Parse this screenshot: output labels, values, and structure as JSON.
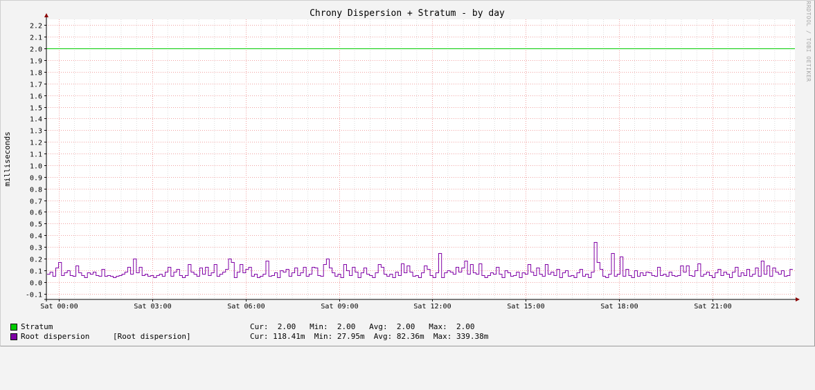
{
  "chart_data": {
    "type": "line",
    "title": "Chrony Dispersion + Stratum - by day",
    "ylabel": "milliseconds",
    "watermark": "RRDTOOL / TOBI OETIKER",
    "ylim": [
      -0.15,
      2.25
    ],
    "y_ticks": [
      "-0.1",
      "0.0",
      "0.1",
      "0.2",
      "0.3",
      "0.4",
      "0.5",
      "0.6",
      "0.7",
      "0.8",
      "0.9",
      "1.0",
      "1.1",
      "1.2",
      "1.3",
      "1.4",
      "1.5",
      "1.6",
      "1.7",
      "1.8",
      "1.9",
      "2.0",
      "2.1",
      "2.2"
    ],
    "y_tick_values": [
      -0.1,
      0.0,
      0.1,
      0.2,
      0.3,
      0.4,
      0.5,
      0.6,
      0.7,
      0.8,
      0.9,
      1.0,
      1.1,
      1.2,
      1.3,
      1.4,
      1.5,
      1.6,
      1.7,
      1.8,
      1.9,
      2.0,
      2.1,
      2.2
    ],
    "xlim_hours": [
      23.6,
      47.65
    ],
    "x_ticks": [
      "Sat 00:00",
      "Sat 03:00",
      "Sat 06:00",
      "Sat 09:00",
      "Sat 12:00",
      "Sat 15:00",
      "Sat 18:00",
      "Sat 21:00"
    ],
    "x_tick_hours": [
      24,
      27,
      30,
      33,
      36,
      39,
      42,
      45
    ],
    "grid": true,
    "legend_position": "bottom",
    "series": [
      {
        "name": "Stratum",
        "color": "#00cc00",
        "values": [
          2.0,
          2.0
        ],
        "stats": {
          "cur": "2.00",
          "min": "2.00",
          "avg": "2.00",
          "max": "2.00"
        }
      },
      {
        "name": "Root dispersion",
        "comment": "[Root dispersion]",
        "color": "#7f00a5",
        "values": [
          0.07,
          0.09,
          0.05,
          0.12,
          0.17,
          0.06,
          0.08,
          0.1,
          0.06,
          0.05,
          0.14,
          0.08,
          0.06,
          0.04,
          0.08,
          0.07,
          0.09,
          0.06,
          0.05,
          0.11,
          0.05,
          0.06,
          0.05,
          0.04,
          0.05,
          0.06,
          0.07,
          0.09,
          0.13,
          0.07,
          0.2,
          0.08,
          0.13,
          0.06,
          0.07,
          0.05,
          0.06,
          0.04,
          0.06,
          0.07,
          0.05,
          0.09,
          0.13,
          0.05,
          0.09,
          0.11,
          0.06,
          0.04,
          0.06,
          0.15,
          0.09,
          0.07,
          0.05,
          0.12,
          0.07,
          0.13,
          0.06,
          0.08,
          0.15,
          0.05,
          0.07,
          0.09,
          0.11,
          0.2,
          0.17,
          0.04,
          0.09,
          0.15,
          0.08,
          0.11,
          0.13,
          0.05,
          0.07,
          0.04,
          0.05,
          0.07,
          0.18,
          0.05,
          0.06,
          0.08,
          0.04,
          0.1,
          0.09,
          0.11,
          0.05,
          0.08,
          0.12,
          0.06,
          0.08,
          0.13,
          0.05,
          0.07,
          0.13,
          0.12,
          0.06,
          0.05,
          0.15,
          0.2,
          0.12,
          0.08,
          0.05,
          0.07,
          0.04,
          0.15,
          0.1,
          0.06,
          0.13,
          0.09,
          0.04,
          0.08,
          0.12,
          0.07,
          0.06,
          0.04,
          0.08,
          0.15,
          0.13,
          0.07,
          0.05,
          0.07,
          0.04,
          0.09,
          0.06,
          0.16,
          0.08,
          0.14,
          0.09,
          0.05,
          0.06,
          0.04,
          0.08,
          0.14,
          0.11,
          0.06,
          0.04,
          0.08,
          0.25,
          0.04,
          0.08,
          0.1,
          0.09,
          0.07,
          0.13,
          0.09,
          0.12,
          0.18,
          0.07,
          0.15,
          0.08,
          0.07,
          0.16,
          0.06,
          0.04,
          0.06,
          0.08,
          0.07,
          0.13,
          0.07,
          0.04,
          0.1,
          0.08,
          0.05,
          0.06,
          0.09,
          0.04,
          0.08,
          0.07,
          0.15,
          0.09,
          0.06,
          0.12,
          0.07,
          0.05,
          0.15,
          0.07,
          0.09,
          0.06,
          0.11,
          0.04,
          0.08,
          0.1,
          0.05,
          0.06,
          0.04,
          0.08,
          0.11,
          0.05,
          0.07,
          0.04,
          0.09,
          0.34,
          0.17,
          0.11,
          0.05,
          0.04,
          0.07,
          0.25,
          0.05,
          0.07,
          0.22,
          0.05,
          0.11,
          0.06,
          0.04,
          0.1,
          0.05,
          0.08,
          0.06,
          0.09,
          0.08,
          0.06,
          0.05,
          0.13,
          0.06,
          0.07,
          0.05,
          0.09,
          0.06,
          0.05,
          0.06,
          0.14,
          0.09,
          0.14,
          0.06,
          0.05,
          0.1,
          0.16,
          0.05,
          0.07,
          0.09,
          0.06,
          0.04,
          0.08,
          0.11,
          0.06,
          0.09,
          0.07,
          0.04,
          0.09,
          0.13,
          0.05,
          0.08,
          0.06,
          0.11,
          0.05,
          0.07,
          0.12,
          0.05,
          0.18,
          0.07,
          0.14,
          0.05,
          0.12,
          0.09,
          0.07,
          0.1,
          0.05,
          0.06,
          0.11
        ],
        "stats": {
          "cur": "118.41m",
          "min": "27.95m",
          "avg": "82.36m",
          "max": "339.38m"
        }
      }
    ]
  },
  "legend": {
    "items": [
      {
        "label": "Stratum",
        "stats_text": "Cur:  2.00   Min:  2.00   Avg:  2.00   Max:  2.00"
      },
      {
        "label": "Root dispersion",
        "comment": "[Root dispersion]",
        "stats_text": "Cur: 118.41m  Min: 27.95m  Avg: 82.36m  Max: 339.38m"
      }
    ]
  }
}
